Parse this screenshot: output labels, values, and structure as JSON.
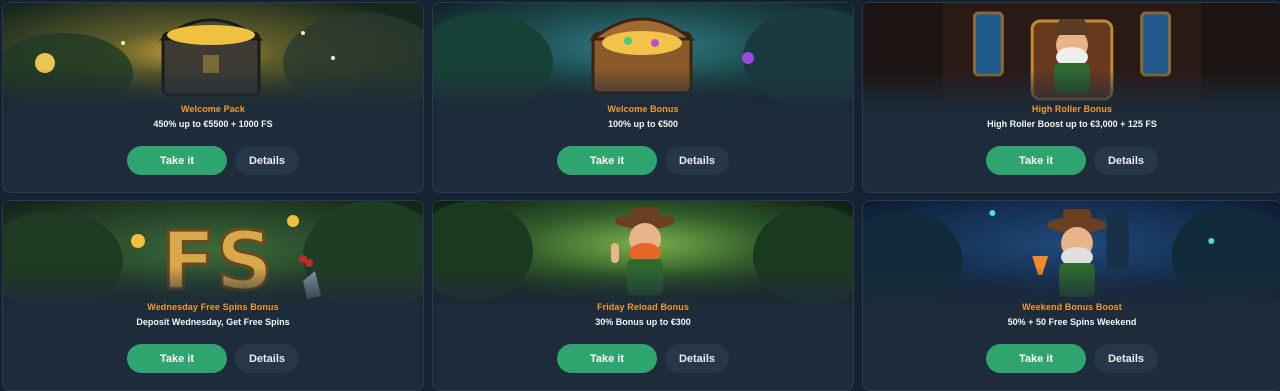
{
  "offers": [
    {
      "title": "Welcome Pack",
      "subtitle": "450% up to €5500 + 1000 FS",
      "take_label": "Take it",
      "details_label": "Details",
      "art": "treasure-chest-forest"
    },
    {
      "title": "Welcome Bonus",
      "subtitle": "100% up to €500",
      "take_label": "Take it",
      "details_label": "Details",
      "art": "treasure-chest-jungle"
    },
    {
      "title": "High Roller Bonus",
      "subtitle": "High Roller Boost up to €3,000 + 125 FS",
      "take_label": "Take it",
      "details_label": "Details",
      "art": "leprechaun-throne"
    },
    {
      "title": "Wednesday Free Spins Bonus",
      "subtitle": "Deposit Wednesday, Get Free Spins",
      "take_label": "Take it",
      "details_label": "Details",
      "art": "stone-fs-letters"
    },
    {
      "title": "Friday Reload Bonus",
      "subtitle": "30% Bonus up to €300",
      "take_label": "Take it",
      "details_label": "Details",
      "art": "leprechaun-waving"
    },
    {
      "title": "Weekend Bonus Boost",
      "subtitle": "50% + 50 Free Spins Weekend",
      "take_label": "Take it",
      "details_label": "Details",
      "art": "leprechaun-cocktail-night"
    }
  ],
  "colors": {
    "page_bg": "#152231",
    "card_bg": "#1d2b3b",
    "title_orange": "#f39a2c",
    "take_button_green": "#2ea56f",
    "details_button_bg": "#263749"
  }
}
